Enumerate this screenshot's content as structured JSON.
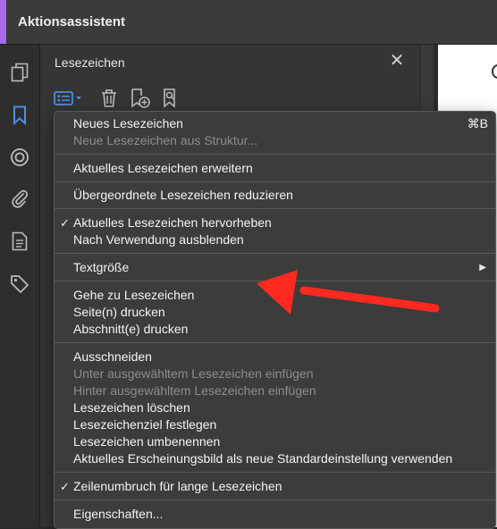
{
  "window": {
    "title": "Aktionsassistent"
  },
  "panel": {
    "title": "Lesezeichen"
  },
  "menu": {
    "shortcut_new": "⌘B",
    "items": [
      "Neues Lesezeichen",
      "Neue Lesezeichen aus Struktur...",
      "Aktuelles Lesezeichen erweitern",
      "Übergeordnete Lesezeichen reduzieren",
      "Aktuelles Lesezeichen hervorheben",
      "Nach Verwendung ausblenden",
      "Textgröße",
      "Gehe zu Lesezeichen",
      "Seite(n) drucken",
      "Abschnitt(e) drucken",
      "Ausschneiden",
      "Unter ausgewähltem Lesezeichen einfügen",
      "Hinter ausgewähltem Lesezeichen einfügen",
      "Lesezeichen löschen",
      "Lesezeichenziel festlegen",
      "Lesezeichen umbenennen",
      "Aktuelles Erscheinungsbild als neue Standardeinstellung verwenden",
      "Zeilenumbruch für lange Lesezeichen",
      "Eigenschaften..."
    ]
  },
  "colors": {
    "accent": "#a86be6",
    "active_icon": "#4a90e2",
    "annotation_arrow": "#ff2a1f"
  }
}
